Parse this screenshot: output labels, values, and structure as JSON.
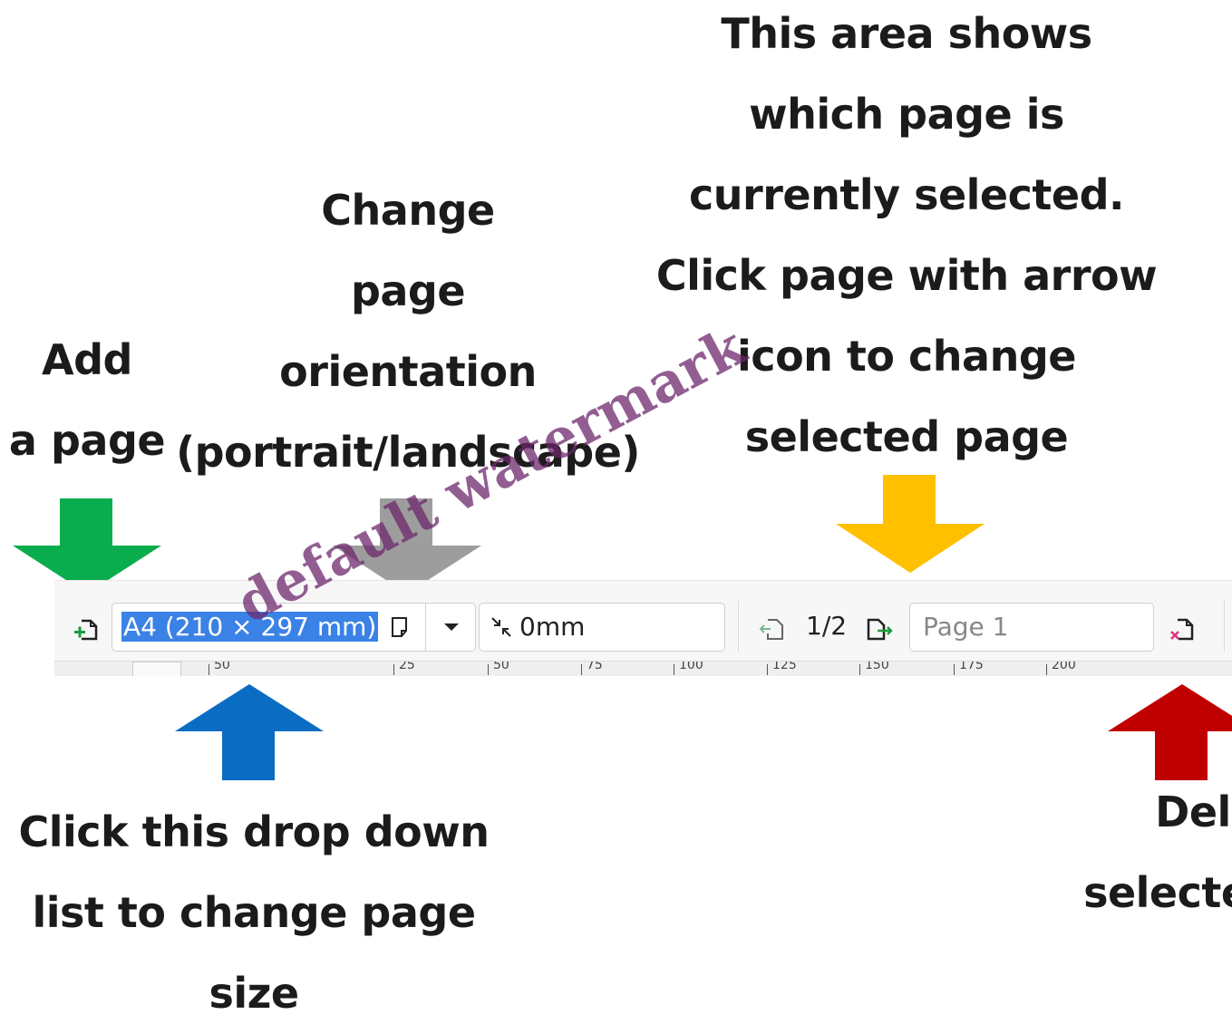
{
  "annotations": {
    "add_page": "Add\na page",
    "orientation": "Change\npage\norientation\n(portrait/landscape)",
    "page_selected": "This area shows\nwhich page is\ncurrently selected.\nClick page with arrow\nicon to change\nselected page",
    "page_size": "Click this drop down\nlist to change page\nsize",
    "delete_page": "Delet\nselected"
  },
  "toolbar": {
    "page_size_value": "A4 (210 × 297 mm)",
    "margin_value": "0mm",
    "page_counter": "1/2",
    "page_label_placeholder": "Page 1",
    "ruler_labels": [
      "50",
      "25",
      "50",
      "75",
      "100",
      "125",
      "150",
      "175",
      "200"
    ]
  },
  "colors": {
    "add_arrow": "#0aad4d",
    "orientation_arrow": "#9d9d9d",
    "page_arrow": "#ffc000",
    "size_arrow": "#0b6cc3",
    "delete_arrow": "#c00000",
    "selection": "#3b82e6"
  },
  "icons": [
    "add-page-icon",
    "page-orientation-icon",
    "dropdown-arrow-icon",
    "margin-icon",
    "previous-page-icon",
    "next-page-icon",
    "delete-page-icon"
  ],
  "watermark": "default watermark"
}
